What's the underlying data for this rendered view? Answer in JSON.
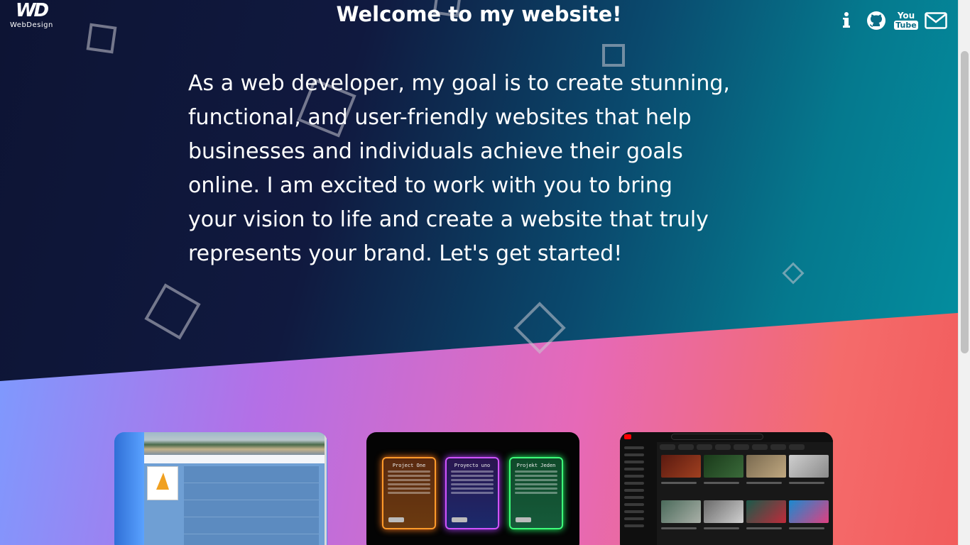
{
  "logo": {
    "mark": "WD",
    "text": "WebDesign"
  },
  "header": {
    "title": "Welcome to my website!"
  },
  "social": [
    {
      "name": "info-icon",
      "label": "info"
    },
    {
      "name": "github-icon",
      "label": "GitHub"
    },
    {
      "name": "youtube-icon",
      "label": "YouTube"
    },
    {
      "name": "mail-icon",
      "label": "mail"
    }
  ],
  "youtube_text": {
    "top": "You",
    "bottom": "Tube"
  },
  "intro": {
    "line1": "As a web developer, my goal is to create stunning,",
    "line2": "functional, and user-friendly websites that help",
    "line3": "businesses and individuals achieve their goals",
    "line4": "online. I am excited to work with you to bring",
    "line5": "your vision to life and create a website that truly",
    "line6": "represents your brand. Let's get started!"
  },
  "projects": {
    "card2": {
      "box1_title": "Project One",
      "box2_title": "Proyecto uno",
      "box3_title": "Projekt Jeden"
    }
  },
  "colors": {
    "hero_dark": "#0d1434",
    "hero_teal": "#048fa0",
    "accent_pink": "#e669b7",
    "accent_coral": "#f25c5c"
  }
}
